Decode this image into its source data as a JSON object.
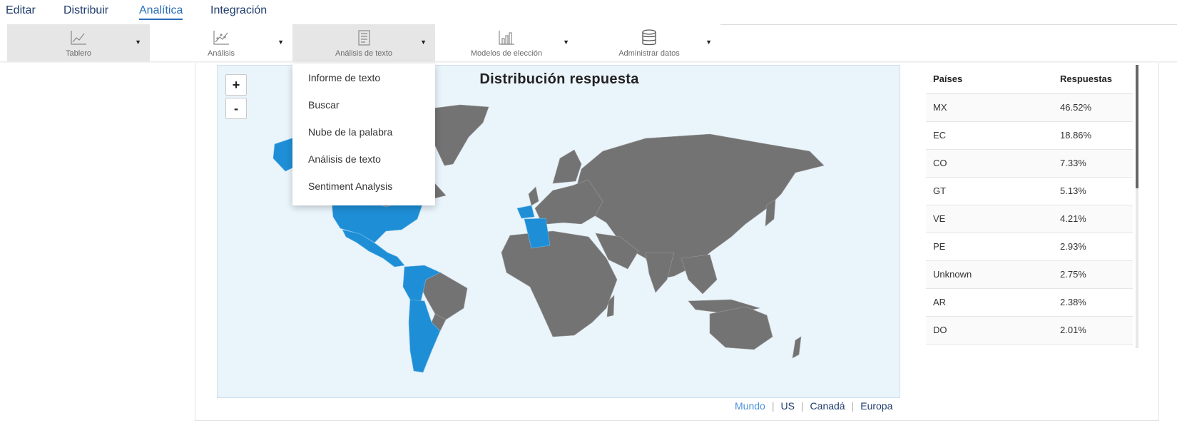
{
  "nav": {
    "items": [
      {
        "label": "Editar",
        "active": false
      },
      {
        "label": "Distribuir",
        "active": false
      },
      {
        "label": "Analítica",
        "active": true
      },
      {
        "label": "Integración",
        "active": false
      }
    ]
  },
  "toolbar": {
    "tools": [
      {
        "label": "Tablero",
        "icon": "line-chart-icon",
        "selected": true
      },
      {
        "label": "Análisis",
        "icon": "scatter-chart-icon",
        "selected": false
      },
      {
        "label": "Análisis de texto",
        "icon": "text-analysis-icon",
        "selected": true
      },
      {
        "label": "Modelos de elección",
        "icon": "bar-trend-icon",
        "selected": false
      },
      {
        "label": "Administrar datos",
        "icon": "database-icon",
        "selected": false
      }
    ]
  },
  "dropdown": {
    "items": [
      "Informe de texto",
      "Buscar",
      "Nube de la palabra",
      "Análisis de texto",
      "Sentiment Analysis"
    ]
  },
  "map": {
    "title": "Distribución respuesta",
    "zoom_in": "+",
    "zoom_out": "-",
    "highlight_color": "#1e8fd6",
    "base_color": "#737373",
    "ocean_color": "#eaf4fb"
  },
  "regions": {
    "links": [
      {
        "label": "Mundo",
        "active": true
      },
      {
        "label": "US",
        "active": false
      },
      {
        "label": "Canadá",
        "active": false
      },
      {
        "label": "Europa",
        "active": false
      }
    ]
  },
  "table": {
    "headers": [
      "Países",
      "Respuestas"
    ],
    "rows": [
      [
        "MX",
        "46.52%"
      ],
      [
        "EC",
        "18.86%"
      ],
      [
        "CO",
        "7.33%"
      ],
      [
        "GT",
        "5.13%"
      ],
      [
        "VE",
        "4.21%"
      ],
      [
        "PE",
        "2.93%"
      ],
      [
        "Unknown",
        "2.75%"
      ],
      [
        "AR",
        "2.38%"
      ],
      [
        "DO",
        "2.01%"
      ]
    ]
  }
}
